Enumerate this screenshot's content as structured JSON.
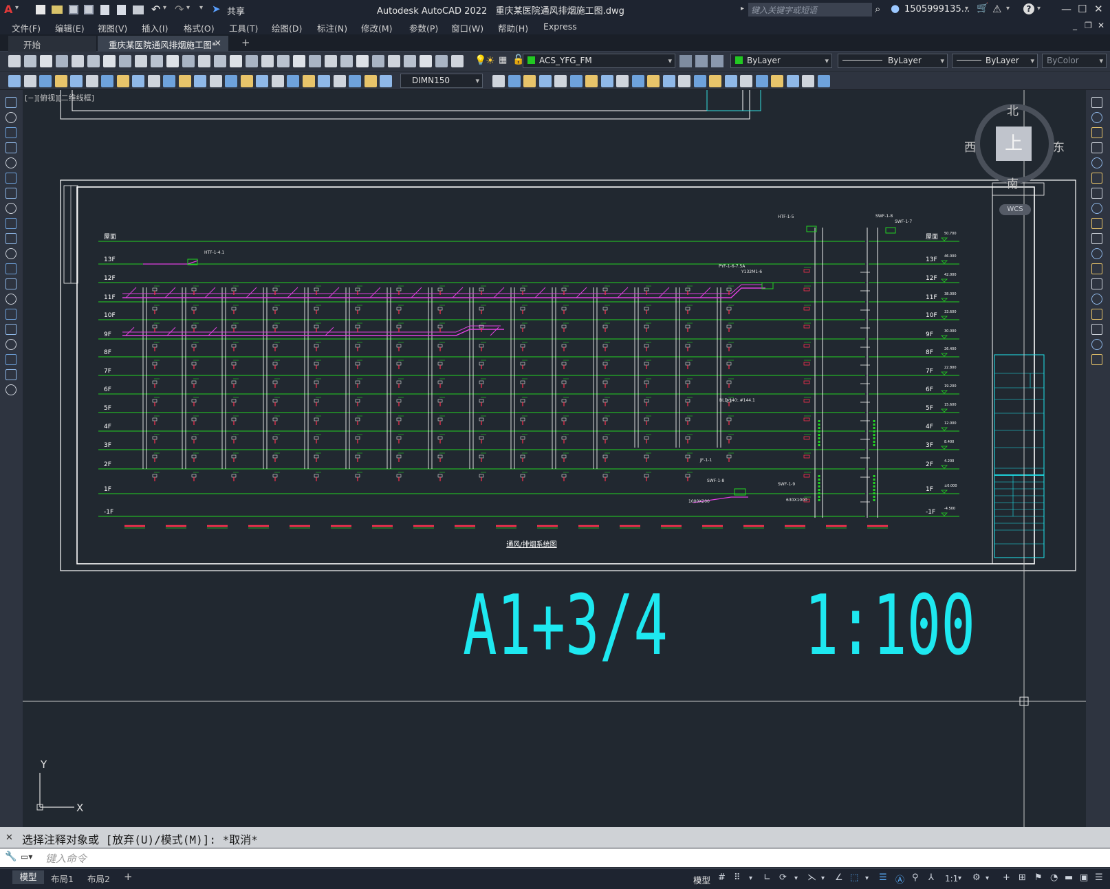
{
  "app": {
    "title": "Autodesk AutoCAD 2022",
    "file": "重庆某医院通风排烟施工图.dwg",
    "logo": "A",
    "share": "共享",
    "search_placeholder": "键入关键字或短语",
    "user": "1505999135...",
    "help": "?"
  },
  "menu": [
    "文件(F)",
    "编辑(E)",
    "视图(V)",
    "插入(I)",
    "格式(O)",
    "工具(T)",
    "绘图(D)",
    "标注(N)",
    "修改(M)",
    "参数(P)",
    "窗口(W)",
    "帮助(H)",
    "Express"
  ],
  "tabs": [
    {
      "label": "开始",
      "active": false
    },
    {
      "label": "重庆某医院通风排烟施工图*",
      "active": true
    }
  ],
  "toolbar": {
    "layer": "ACS_YFG_FM",
    "color": "ByLayer",
    "linetype": "ByLayer",
    "lineweight": "ByLayer",
    "plotstyle": "ByColor",
    "dimstyle": "DIMN150"
  },
  "viewport": {
    "label": "[−][俯视][二维线框]",
    "viewcube": {
      "north": "北",
      "south": "南",
      "east": "东",
      "west": "西",
      "face": "上",
      "wcs": "WCS"
    }
  },
  "drawing": {
    "title": "通风/排烟系统图",
    "scale_text": "A1+3/4    1:100",
    "floors_left": [
      "屋面",
      "13F",
      "12F",
      "11F",
      "10F",
      "9F",
      "8F",
      "7F",
      "6F",
      "5F",
      "4F",
      "3F",
      "2F",
      "1F",
      "-1F"
    ],
    "floors_right": [
      "屋面",
      "13F",
      "12F",
      "11F",
      "10F",
      "9F",
      "8F",
      "7F",
      "6F",
      "5F",
      "4F",
      "3F",
      "2F",
      "1F",
      "-1F"
    ],
    "elevations": [
      "50.700",
      "46.000",
      "42.000",
      "38.000",
      "33.600",
      "30.000",
      "26.400",
      "22.800",
      "19.200",
      "15.600",
      "12.000",
      "8.400",
      "4.200",
      "±0.000",
      "-4.500"
    ],
    "annotations": [
      "HTF-1-4.1",
      "HTF-1-5",
      "SWF-1-7",
      "SWF-1-8",
      "SWF-1-9",
      "SWF-1-8",
      "PYF-1-6-7.5A",
      "Y132M1-6",
      "BLD-140:.#144.1",
      "1000X200",
      "630X1000",
      "JF-1-1"
    ]
  },
  "axes": {
    "x": "X",
    "y": "Y"
  },
  "command": {
    "history": "选择注释对象或 [放弃(U)/模式(M)]: *取消*",
    "placeholder": "键入命令"
  },
  "status": {
    "tabs": [
      "模型",
      "布局1",
      "布局2"
    ],
    "model_label": "模型",
    "scale": "1:1"
  }
}
